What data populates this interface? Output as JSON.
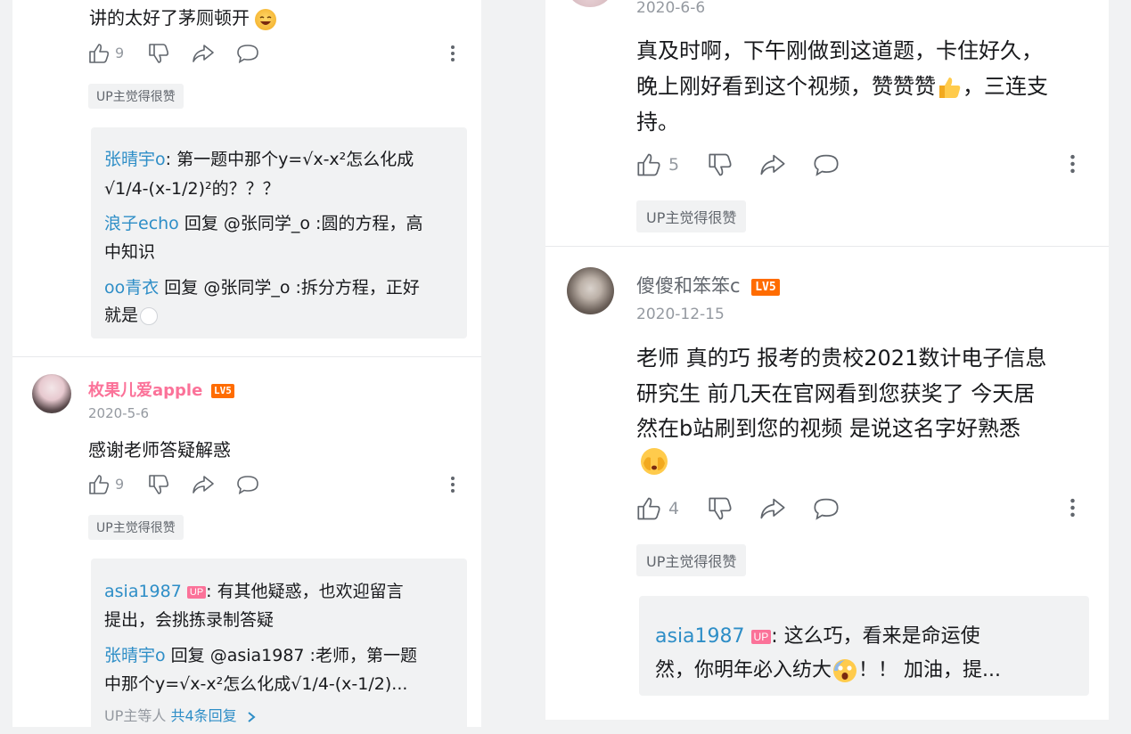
{
  "left": {
    "top_comment": {
      "text": "讲的太好了茅厕顿开",
      "likes": "9",
      "tag": "UP主觉得很赞",
      "replies": [
        {
          "user": "张晴宇o",
          "line1": ": 第一题中那个y=√x-x²怎么化成",
          "line2": "√1/4-(x-1/2)²的？？？"
        },
        {
          "user": "浪子echo",
          "line1": " 回复 @张同学_o :圆的方程，高",
          "line2": "中知识"
        },
        {
          "user": "oo青衣",
          "line1": " 回复 @张同学_o :拆分方程，正好",
          "line2": "就是"
        }
      ]
    },
    "comment2": {
      "user": "枚果儿爱apple",
      "level": "LV5",
      "date": "2020-5-6",
      "text": "感谢老师答疑解惑",
      "likes": "9",
      "tag": "UP主觉得很赞",
      "replies": [
        {
          "user": "asia1987",
          "badge": "UP",
          "line1": ": 有其他疑惑，也欢迎留言",
          "line2": "提出，会挑拣录制答疑"
        },
        {
          "user": "张晴宇o",
          "line1": " 回复 @asia1987 :老师，第一题",
          "line2": "中那个y=√x-x²怎么化成√1/4-(x-1/2)..."
        }
      ],
      "more_prefix": "UP主等人 ",
      "more_link": "共4条回复"
    }
  },
  "right": {
    "comment1": {
      "date": "2020-6-6",
      "line1": "真及时啊，下午刚做到这道题，卡住好久，",
      "line2a": "晚上刚好看到这个视频，赞赞赞",
      "line2b": "，三连支",
      "line3": "持。",
      "likes": "5",
      "tag": "UP主觉得很赞"
    },
    "comment2": {
      "user": "傻傻和笨笨c",
      "level": "LV5",
      "date": "2020-12-15",
      "line1": "老师 真的巧 报考的贵校2021数计电子信息",
      "line2": "研究生 前几天在官网看到您获奖了 今天居",
      "line3": "然在b站刷到您的视频 是说这名字好熟悉",
      "likes": "4",
      "tag": "UP主觉得很赞",
      "reply": {
        "user": "asia1987",
        "badge": "UP",
        "line1": ": 这么巧，看来是命运使",
        "line2a": "然，你明年必入纺大",
        "line2b": "！！ 加油，提..."
      }
    }
  },
  "colors": {
    "username_pink": "#fb7299",
    "link_blue": "#2e8ec7",
    "level_orange": "#ff6c00",
    "tag_bg": "#f1f2f3"
  }
}
